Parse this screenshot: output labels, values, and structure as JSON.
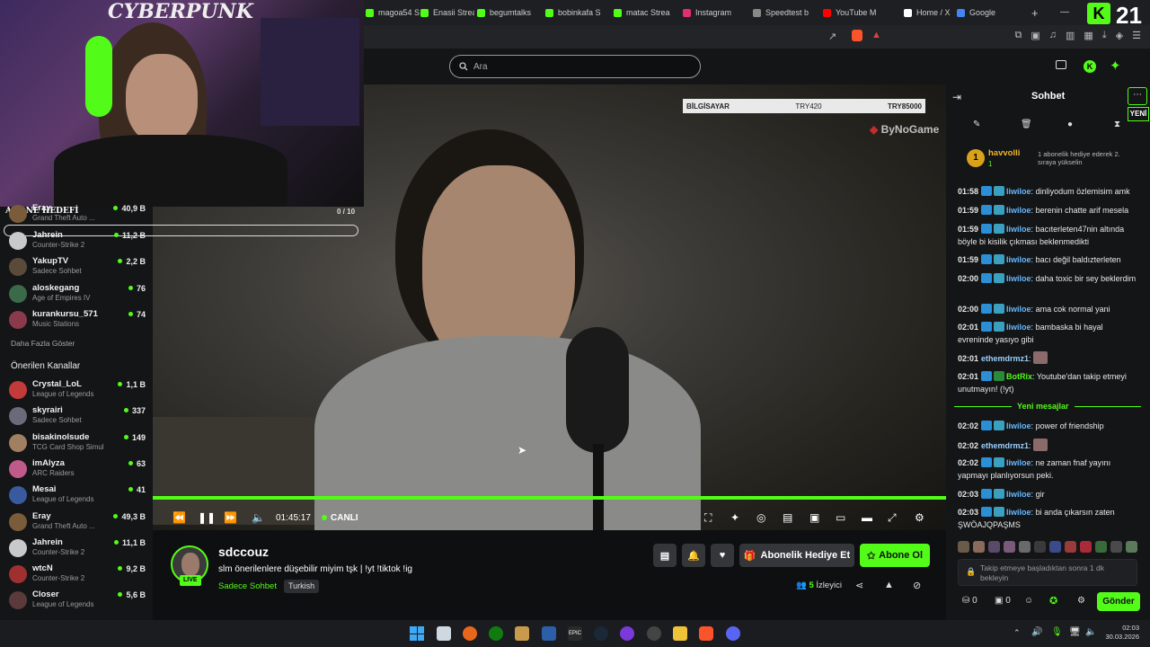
{
  "browser": {
    "tabs": [
      {
        "label": "magoa54 S",
        "color": "#53fc18"
      },
      {
        "label": "Enasii Strean",
        "color": "#53fc18"
      },
      {
        "label": "begumtalks",
        "color": "#53fc18"
      },
      {
        "label": "bobinkafa S",
        "color": "#53fc18"
      },
      {
        "label": "matac Strea",
        "color": "#53fc18"
      },
      {
        "label": "Instagram",
        "color": "#e1306c"
      },
      {
        "label": "Speedtest b",
        "color": "#888888"
      },
      {
        "label": "YouTube M",
        "color": "#ff0000"
      },
      {
        "label": "Home / X",
        "color": "#ffffff"
      },
      {
        "label": "Google",
        "color": "#4285f4"
      }
    ],
    "new_tab": "+",
    "badge": "21"
  },
  "site": {
    "search_placeholder": "Ara"
  },
  "webcam": {
    "sign_text": "CYBERPUNK",
    "goal_label": "ABONE HEDEFİ",
    "goal_count": "0 / 10"
  },
  "sidebar": {
    "followed": [
      {
        "name": "Eray",
        "game": "Grand Theft Auto ...",
        "viewers": "40,9 B",
        "color": "#7a5c3a"
      },
      {
        "name": "Jahrein",
        "game": "Counter-Strike 2",
        "viewers": "11,2 B",
        "color": "#c9c9c9"
      },
      {
        "name": "YakupTV",
        "game": "Sadece Sohbet",
        "viewers": "2,2 B",
        "color": "#5a4a3a"
      },
      {
        "name": "aloskegang",
        "game": "Age of Empires IV",
        "viewers": "76",
        "color": "#3a6a4a"
      },
      {
        "name": "kurankursu_571",
        "game": "Music Stations",
        "viewers": "74",
        "color": "#8a3a4a"
      }
    ],
    "show_more": "Daha Fazla Göster",
    "recommended_title": "Önerilen Kanallar",
    "recommended": [
      {
        "name": "Crystal_LoL",
        "game": "League of Legends",
        "viewers": "1,1 B",
        "color": "#c23a3a"
      },
      {
        "name": "skyrairi",
        "game": "Sadece Sohbet",
        "viewers": "337",
        "color": "#6a6a7a"
      },
      {
        "name": "bisakinolsude",
        "game": "TCG Card Shop Simul...",
        "viewers": "149",
        "color": "#a08060"
      },
      {
        "name": "imAlyza",
        "game": "ARC Raiders",
        "viewers": "63",
        "color": "#c05a8a"
      },
      {
        "name": "Mesai",
        "game": "League of Legends",
        "viewers": "41",
        "color": "#3a5aa0"
      },
      {
        "name": "Eray",
        "game": "Grand Theft Auto ...",
        "viewers": "49,3 B",
        "color": "#7a5c3a"
      },
      {
        "name": "Jahrein",
        "game": "Counter-Strike 2",
        "viewers": "11,1 B",
        "color": "#c9c9c9"
      },
      {
        "name": "wtcN",
        "game": "Counter-Strike 2",
        "viewers": "9,2 B",
        "color": "#a03030"
      },
      {
        "name": "Closer",
        "game": "League of Legends",
        "viewers": "5,6 B",
        "color": "#5a3a3a"
      }
    ]
  },
  "video": {
    "scoreboard": [
      "BİLGİSAYAR",
      "TRY420",
      "TRY85000"
    ],
    "watermark": "ByNoGame",
    "time": "01:45:17",
    "live_label": "CANLI"
  },
  "stream": {
    "channel": "sdccouz",
    "live_badge": "LIVE",
    "title": "slm önerilenlere düşebilir miyim tşk | !yt !tiktok !ig",
    "category": "Sadece Sohbet",
    "tag": "Turkish",
    "viewers_count": "5",
    "viewers_label": "İzleyici",
    "gift_button": "Abonelik Hediye Et",
    "subscribe_button": "Abone Ol"
  },
  "chat": {
    "title": "Sohbet",
    "new_label": "YENİ",
    "pinned_user": "havvolli",
    "pinned_count": "1",
    "pinned_text": "1 abonelik hediye ederek 2. sıraya yükselin",
    "messages": [
      {
        "time": "01:58",
        "user": "liwiloe",
        "text": "dinliyodum özlemisim amk"
      },
      {
        "time": "01:59",
        "user": "liwiloe",
        "text": "berenin chatte arif mesela"
      },
      {
        "time": "01:59",
        "user": "liwiloe",
        "text": "bacıterleten47nin altında böyle bi kisilik çıkması beklenmedikti"
      },
      {
        "time": "01:59",
        "user": "liwiloe",
        "text": "bacı değil baldızterleten"
      },
      {
        "time": "02:00",
        "user": "liwiloe",
        "text": "daha toxic bir sey beklerdim"
      },
      {
        "time": "02:00",
        "user": "liwiloe",
        "text": "ama cok normal yani"
      },
      {
        "time": "02:01",
        "user": "liwiloe",
        "text": "bambaska bi hayal evreninde yasıyo gibi"
      },
      {
        "time": "02:01",
        "user": "ethemdrmz1",
        "text": ""
      },
      {
        "time": "02:01",
        "user": "BotRix",
        "text": "Youtube'dan takip etmeyi unutmayın! (!yt)"
      }
    ],
    "divider": "Yeni mesajlar",
    "new_messages": [
      {
        "time": "02:02",
        "user": "liwiloe",
        "text": "power of friendship"
      },
      {
        "time": "02:02",
        "user": "ethemdrmz1",
        "text": ""
      },
      {
        "time": "02:02",
        "user": "liwiloe",
        "text": "ne zaman fnaf yayını yapmayı planlıyorsun peki."
      },
      {
        "time": "02:03",
        "user": "liwiloe",
        "text": "gir"
      },
      {
        "time": "02:03",
        "user": "liwiloe",
        "text": "bi anda çıkarsın zaten ŞWÖAJQPAŞMS"
      }
    ],
    "input_placeholder": "Takip etmeye başladıktan sonra 1 dk bekleyin",
    "count_a": "0",
    "count_b": "0",
    "send_button": "Gönder"
  },
  "taskbar": {
    "time": "02:03",
    "date": "30.03.2026"
  }
}
